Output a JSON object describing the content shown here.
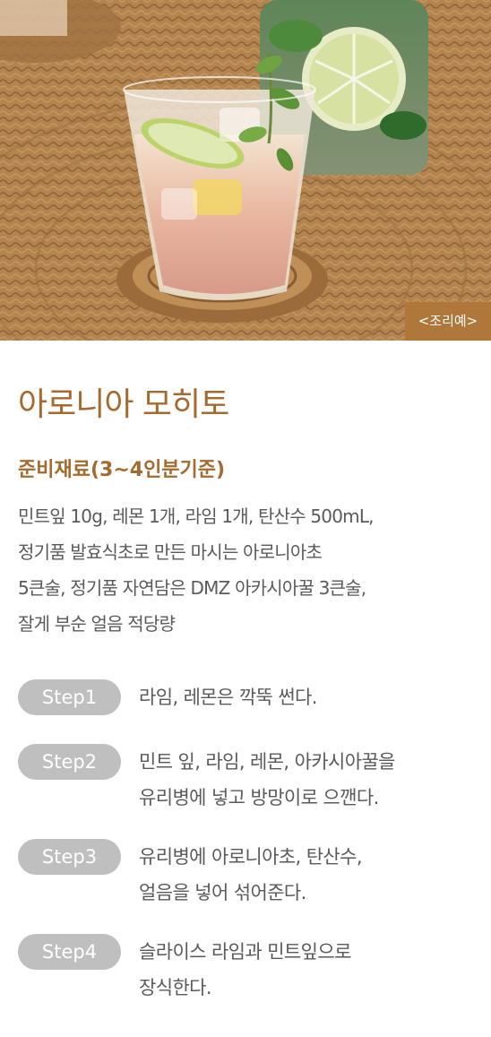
{
  "photo": {
    "alt": "아로니아 모히토",
    "caption": "<조리예>"
  },
  "recipe": {
    "title": "아로니아 모히토",
    "subtitle": "준비재료(3~4인분기준)",
    "ingredients_lines": [
      "민트잎 10g, 레몬 1개, 라임 1개, 탄산수 500mL,",
      "정기품 발효식초로 만든 마시는 아로니아초",
      "5큰술, 정기품 자연담은 DMZ 아카시아꿀 3큰술,",
      "잘게 부순 얼음 적당량"
    ],
    "steps": [
      {
        "label": "Step1",
        "lines": [
          "라임, 레몬은 깍뚝 썬다."
        ]
      },
      {
        "label": "Step2",
        "lines": [
          "민트 잎, 라임, 레몬, 아카시아꿀을",
          "유리병에 넣고 방망이로 으깬다."
        ]
      },
      {
        "label": "Step3",
        "lines": [
          "유리병에 아로니아초, 탄산수,",
          "얼음을 넣어 섞어준다."
        ]
      },
      {
        "label": "Step4",
        "lines": [
          "슬라이스 라임과 민트잎으로",
          "장식한다."
        ]
      }
    ]
  },
  "colors": {
    "accent": "#a46a2e",
    "badge": "#b0773a",
    "pill": "#bfbfbf",
    "text": "#5a5a5a"
  }
}
